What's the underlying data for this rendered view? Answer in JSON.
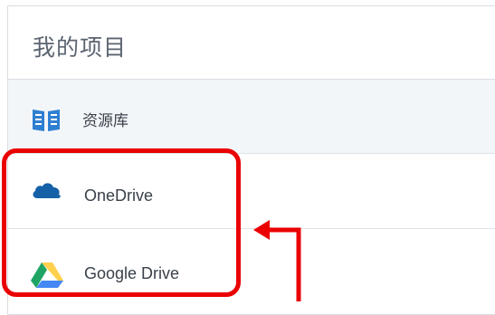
{
  "header": {
    "title": "我的项目"
  },
  "items": [
    {
      "label": "资源库",
      "icon": "library-book-icon"
    },
    {
      "label": "OneDrive",
      "icon": "onedrive-cloud-icon"
    },
    {
      "label": "Google Drive",
      "icon": "google-drive-icon"
    }
  ],
  "colors": {
    "highlight": "#ea0000",
    "onedrive_blue": "#1561a8",
    "library_blue": "#2f7fd1",
    "gdrive_green": "#1fa463",
    "gdrive_yellow": "#ffd04b",
    "gdrive_blue": "#4688f4"
  }
}
